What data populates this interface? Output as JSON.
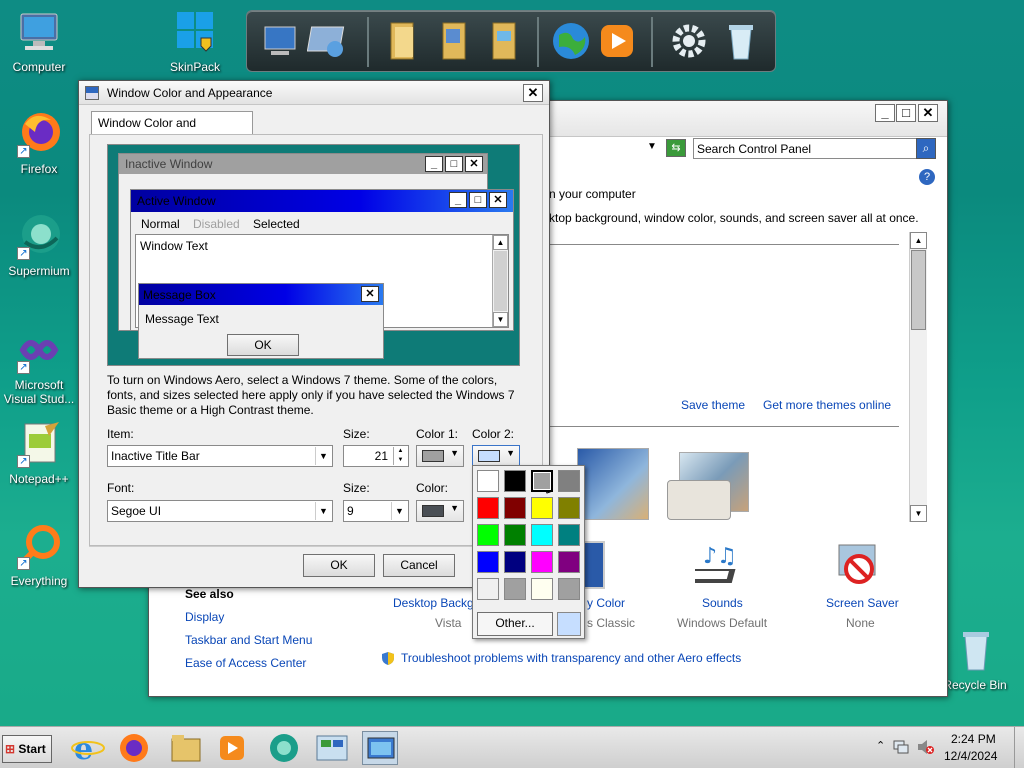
{
  "desktop": {
    "icons": [
      {
        "label": "Computer"
      },
      {
        "label": "SkinPack"
      },
      {
        "label": "Firefox"
      },
      {
        "label": "Supermium"
      },
      {
        "label": "Microsoft Visual Stud..."
      },
      {
        "label": "Notepad++"
      },
      {
        "label": "Everything"
      },
      {
        "label": "Recycle Bin"
      }
    ]
  },
  "control_panel": {
    "search_placeholder": "Search Control Panel",
    "help_icon": "help-icon",
    "text_line1": "n your computer",
    "text_line2": "ktop background, window color, sounds, and screen saver all at once.",
    "save_theme": "Save theme",
    "get_more_themes": "Get more themes online",
    "see_also_title": "See also",
    "see_also_links": [
      "Display",
      "Taskbar and Start Menu",
      "Ease of Access Center"
    ],
    "bottom_items": [
      {
        "title": "Desktop Backg",
        "sub": "Vista"
      },
      {
        "title": "y Color",
        "sub": "s Classic"
      },
      {
        "title": "Sounds",
        "sub": "Windows Default"
      },
      {
        "title": "Screen Saver",
        "sub": "None"
      }
    ],
    "troubleshoot": "Troubleshoot problems with transparency and other Aero effects"
  },
  "dialog": {
    "title": "Window Color and Appearance",
    "tab": "Window Color and Appearance",
    "preview": {
      "inactive_title": "Inactive Window",
      "active_title": "Active Window",
      "menu": [
        "Normal",
        "Disabled",
        "Selected"
      ],
      "window_text": "Window Text",
      "msgbox_title": "Message Box",
      "msgbox_text": "Message Text",
      "ok": "OK"
    },
    "info_text": "To turn on Windows Aero, select a Windows 7 theme.  Some of the colors, fonts, and sizes selected here apply only if you have selected the Windows 7 Basic theme or a High Contrast theme.",
    "item_label": "Item:",
    "item_value": "Inactive Title Bar",
    "size_label": "Size:",
    "size_value": "21",
    "color1_label": "Color 1:",
    "color2_label": "Color 2:",
    "font_label": "Font:",
    "font_value": "Segoe UI",
    "font_size_label": "Size:",
    "font_size_value": "9",
    "font_color_label": "Color:",
    "ok": "OK",
    "cancel": "Cancel",
    "colors": {
      "color1": "#a0a0a0",
      "color2": "#c6deff",
      "font_color": "#4a4f55"
    }
  },
  "palette": {
    "colors": [
      "#ffffff",
      "#000000",
      "#a0a0a0",
      "#808080",
      "#ff0000",
      "#800000",
      "#ffff00",
      "#808000",
      "#00ff00",
      "#008000",
      "#00ffff",
      "#008080",
      "#0000ff",
      "#000080",
      "#ff00ff",
      "#800080",
      "#f0f0f0",
      "#a0a0a0",
      "#fffff0",
      "#a0a0a0"
    ],
    "other": "Other..."
  },
  "taskbar": {
    "start": "Start",
    "time": "2:24 PM",
    "date": "12/4/2024"
  }
}
